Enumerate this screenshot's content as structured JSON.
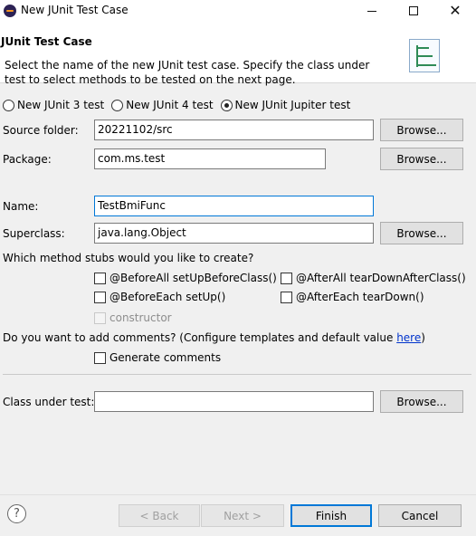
{
  "window": {
    "title": "New JUnit Test Case"
  },
  "header": {
    "title": "JUnit Test Case",
    "description": "Select the name of the new JUnit test case. Specify the class under test to select methods to be tested on the next page."
  },
  "junit_version": {
    "options": [
      "New JUnit 3 test",
      "New JUnit 4 test",
      "New JUnit Jupiter test"
    ],
    "selected_index": 2
  },
  "source_folder": {
    "label": "Source folder:",
    "value": "20221102/src",
    "browse_label": "Browse..."
  },
  "package": {
    "label": "Package:",
    "value": "com.ms.test",
    "browse_label": "Browse..."
  },
  "name": {
    "label": "Name:",
    "value": "TestBmiFunc"
  },
  "superclass": {
    "label": "Superclass:",
    "value": "java.lang.Object",
    "browse_label": "Browse..."
  },
  "stubs": {
    "question": "Which method stubs would you like to create?",
    "before_all": "@BeforeAll setUpBeforeClass()",
    "after_all": "@AfterAll tearDownAfterClass()",
    "before_each": "@BeforeEach setUp()",
    "after_each": "@AfterEach tearDown()",
    "constructor": "constructor"
  },
  "comments": {
    "question_prefix": "Do you want to add comments? (Configure templates and default value ",
    "link": "here",
    "question_suffix": ")",
    "generate_label": "Generate comments"
  },
  "class_under_test": {
    "label": "Class under test:",
    "value": "",
    "browse_label": "Browse..."
  },
  "footer": {
    "help_glyph": "?",
    "back_label": "< Back",
    "next_label": "Next >",
    "finish_label": "Finish",
    "cancel_label": "Cancel"
  }
}
